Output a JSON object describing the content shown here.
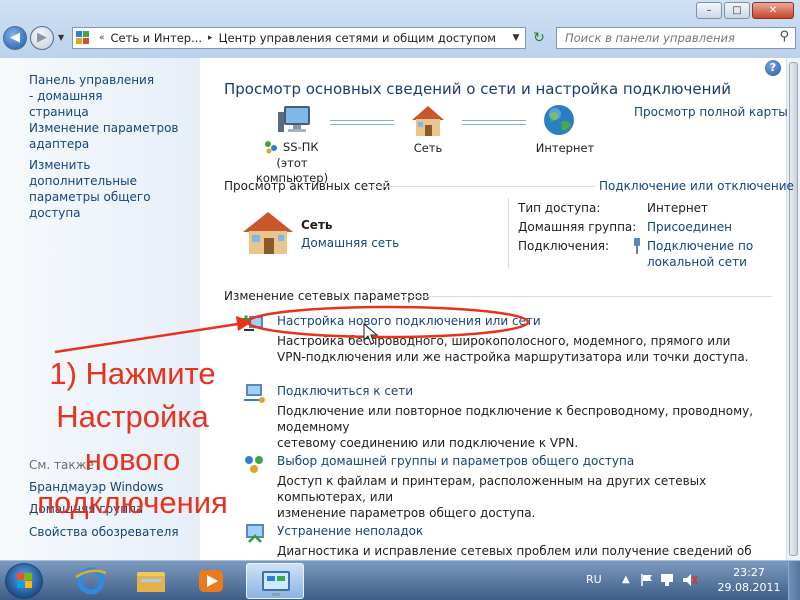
{
  "window": {
    "minimize_glyph": "–",
    "maximize_glyph": "□",
    "close_glyph": "✕",
    "back_glyph": "◀",
    "forward_glyph": "▶",
    "history_glyph": "▼"
  },
  "address_bar": {
    "icon": "control-panel-icon",
    "overflow_glyph": "«",
    "separator_glyph": "▸",
    "dropdown_glyph": "▼",
    "segments": [
      "Сеть и Интер...",
      "Центр управления сетями и общим доступом"
    ],
    "refresh_glyph": "↻"
  },
  "search": {
    "placeholder": "Поиск в панели управления",
    "icon_glyph": "⚲"
  },
  "sidebar": {
    "items": [
      "Панель управления - домашняя страница",
      "Изменение параметров адаптера",
      "Изменить дополнительные параметры общего доступа"
    ],
    "see_also_label": "См. также",
    "see_also": [
      "Брандмауэр Windows",
      "Домашняя группа",
      "Свойства обозревателя"
    ]
  },
  "main": {
    "help_glyph": "?",
    "heading": "Просмотр основных сведений о сети и настройка подключений",
    "full_map_link": "Просмотр полной карты",
    "map": {
      "computer_name": "SS-ПК",
      "computer_caption": "(этот компьютер)",
      "network_label": "Сеть",
      "internet_label": "Интернет"
    },
    "active_networks": {
      "title": "Просмотр активных сетей",
      "connect_link": "Подключение или отключение",
      "network_name": "Сеть",
      "network_type": "Домашняя сеть",
      "access_type_label": "Тип доступа:",
      "access_type_value": "Интернет",
      "homegroup_label": "Домашняя группа:",
      "homegroup_value": "Присоединен",
      "connections_label": "Подключения:",
      "connections_value_line1": "Подключение по",
      "connections_value_line2": "локальной сети"
    },
    "change_settings": {
      "title": "Изменение сетевых параметров",
      "tasks": [
        {
          "title": "Настройка нового подключения или сети",
          "desc_line1": "Настройка беспроводного, широкополосного, модемного, прямого или",
          "desc_line2": "VPN-подключения или же настройка маршрутизатора или точки доступа."
        },
        {
          "title": "Подключиться к сети",
          "desc_line1": "Подключение или повторное подключение к беспроводному, проводному, модемному",
          "desc_line2": "сетевому соединению или подключение к VPN."
        },
        {
          "title": "Выбор домашней группы и параметров общего доступа",
          "desc_line1": "Доступ к файлам и принтерам, расположенным на других сетевых компьютерах, или",
          "desc_line2": "изменение параметров общего доступа."
        },
        {
          "title": "Устранение неполадок",
          "desc_line1": "Диагностика и исправление сетевых проблем или получение сведений об исправлении.",
          "desc_line2": ""
        }
      ]
    }
  },
  "annotation": {
    "lines": [
      "1) Нажмите",
      "Настройка",
      "нового",
      "подключения"
    ],
    "color": "#e8321c"
  },
  "taskbar": {
    "pinned": [
      "internet-explorer-icon",
      "windows-explorer-icon",
      "media-player-icon",
      "network-center-icon"
    ],
    "language": "RU",
    "tray_icons": [
      "show-hidden-icons-icon",
      "action-center-flag-icon",
      "network-icon",
      "volume-icon"
    ],
    "time": "23:27",
    "date": "29.08.2011"
  }
}
